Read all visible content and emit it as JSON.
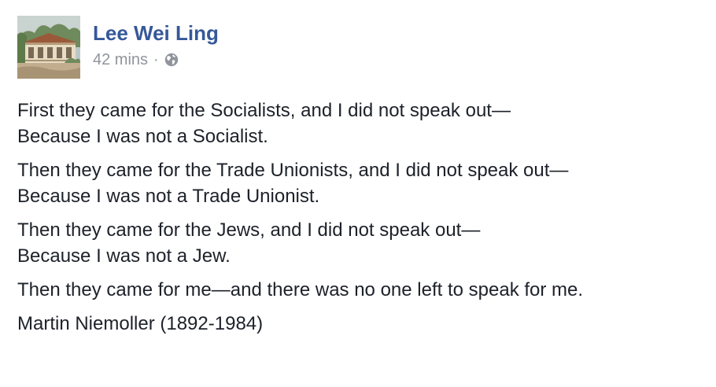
{
  "post": {
    "author": {
      "name": "Lee Wei Ling",
      "avatar_icon": "building-photo-avatar"
    },
    "timestamp": "42 mins",
    "separator": "·",
    "privacy_icon": "globe-icon",
    "body": {
      "paragraphs": [
        [
          "First they came for the Socialists, and I did not speak out—",
          "Because I was not a Socialist."
        ],
        [
          "Then they came for the Trade Unionists, and I did not speak out—",
          "Because I was not a Trade Unionist."
        ],
        [
          "Then they came for the Jews, and I did not speak out—",
          "Because I was not a Jew."
        ],
        [
          "Then they came for me—and there was no one left to speak for me."
        ],
        [
          "Martin Niemoller (1892-1984)"
        ]
      ]
    }
  },
  "colors": {
    "author_link": "#365899",
    "meta_text": "#90949c",
    "body_text": "#1d2129"
  }
}
